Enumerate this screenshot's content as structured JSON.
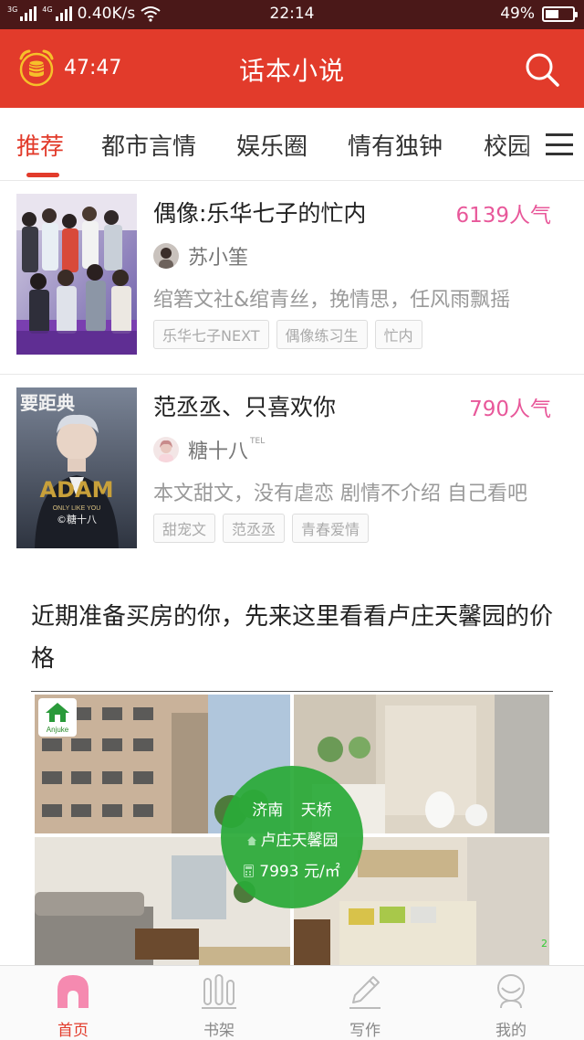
{
  "status_bar": {
    "net1": "3G",
    "net2": "4G",
    "speed": "0.40K/s",
    "time": "22:14",
    "battery": "49%",
    "battery_level": 0.49
  },
  "header": {
    "timer": "47:47",
    "title": "话本小说"
  },
  "tabs": [
    {
      "label": "推荐",
      "active": true
    },
    {
      "label": "都市言情"
    },
    {
      "label": "娱乐圈"
    },
    {
      "label": "情有独钟"
    },
    {
      "label": "校园"
    }
  ],
  "books": [
    {
      "title": "偶像:乐华七子的忙内",
      "popularity": "6139人气",
      "author": "苏小筀",
      "description": "绾箬文社&绾青丝，挽情思，任风雨飘摇",
      "tags": [
        "乐华七子NEXT",
        "偶像练习生",
        "忙内"
      ]
    },
    {
      "title": "范丞丞、只喜欢你",
      "popularity": "790人气",
      "author": "糖十八",
      "author_badge": "TEL",
      "description": "本文甜文，没有虐恋 剧情不介绍 自己看吧",
      "tags": [
        "甜宠文",
        "范丞丞",
        "青春爱情"
      ],
      "cover_text_top": "要距典",
      "cover_text_main": "ADAM",
      "cover_text_sub": "ONLY LIKE YOU",
      "cover_credit": "©糖十八"
    }
  ],
  "ad": {
    "headline": "近期准备买房的你，先来这里看看卢庄天馨园的价格",
    "logo_text": "Anjuke",
    "city": "济南",
    "district": "天桥",
    "community": "卢庄天馨园",
    "price": "7993 元/㎡",
    "page": "2"
  },
  "bottom_nav": [
    {
      "label": "首页",
      "icon": "home-icon",
      "active": true
    },
    {
      "label": "书架",
      "icon": "bookshelf-icon"
    },
    {
      "label": "写作",
      "icon": "pen-icon"
    },
    {
      "label": "我的",
      "icon": "profile-icon"
    }
  ],
  "colors": {
    "brand_red": "#e23b2b",
    "popularity_pink": "#e8589a",
    "ad_green": "#2aaa38"
  }
}
